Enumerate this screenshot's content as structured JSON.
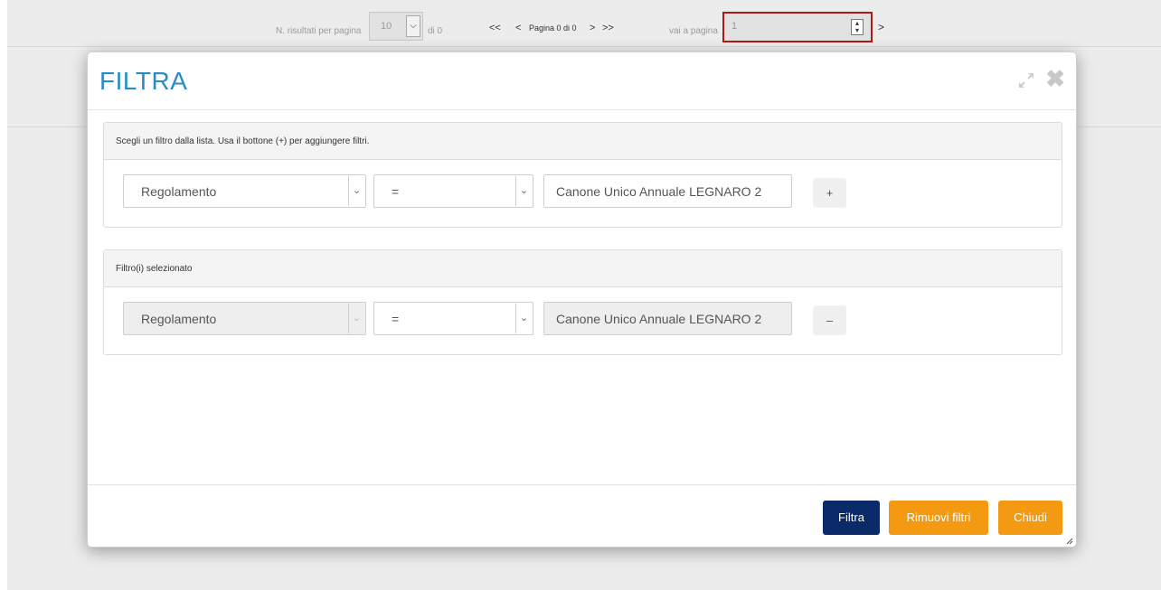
{
  "pager": {
    "results_per_page_label": "N. risultati per pagina",
    "results_per_page_value": "10",
    "of_label": "di 0",
    "first_label": "<<",
    "prev_label": "<",
    "page_status": "Pagina 0 di 0",
    "next_label": ">",
    "last_label": ">>",
    "goto_label": "vai a pagina",
    "goto_value": "1",
    "goto_button": ">"
  },
  "modal": {
    "title": "FILTRA",
    "close_symbol": "✖",
    "filter_panel": {
      "heading": "Scegli un filtro dalla lista. Usa il bottone (+) per aggiungere filtri.",
      "field_value": "Regolamento",
      "operator_value": "=",
      "text_value": "Canone Unico Annuale LEGNARO 2",
      "add_button": "+"
    },
    "selected_panel": {
      "heading": "Filtro(i) selezionato",
      "field_value": "Regolamento",
      "operator_value": "=",
      "text_value": "Canone Unico Annuale LEGNARO 2",
      "remove_button": "–"
    },
    "footer": {
      "filter_button": "Filtra",
      "remove_filters_button": "Rimuovi filtri",
      "close_button": "Chiudi"
    }
  },
  "colors": {
    "title": "#2b8cc4",
    "primary_button": "#0a2a6a",
    "warning_button": "#f39a12",
    "goto_border": "#b01818"
  }
}
